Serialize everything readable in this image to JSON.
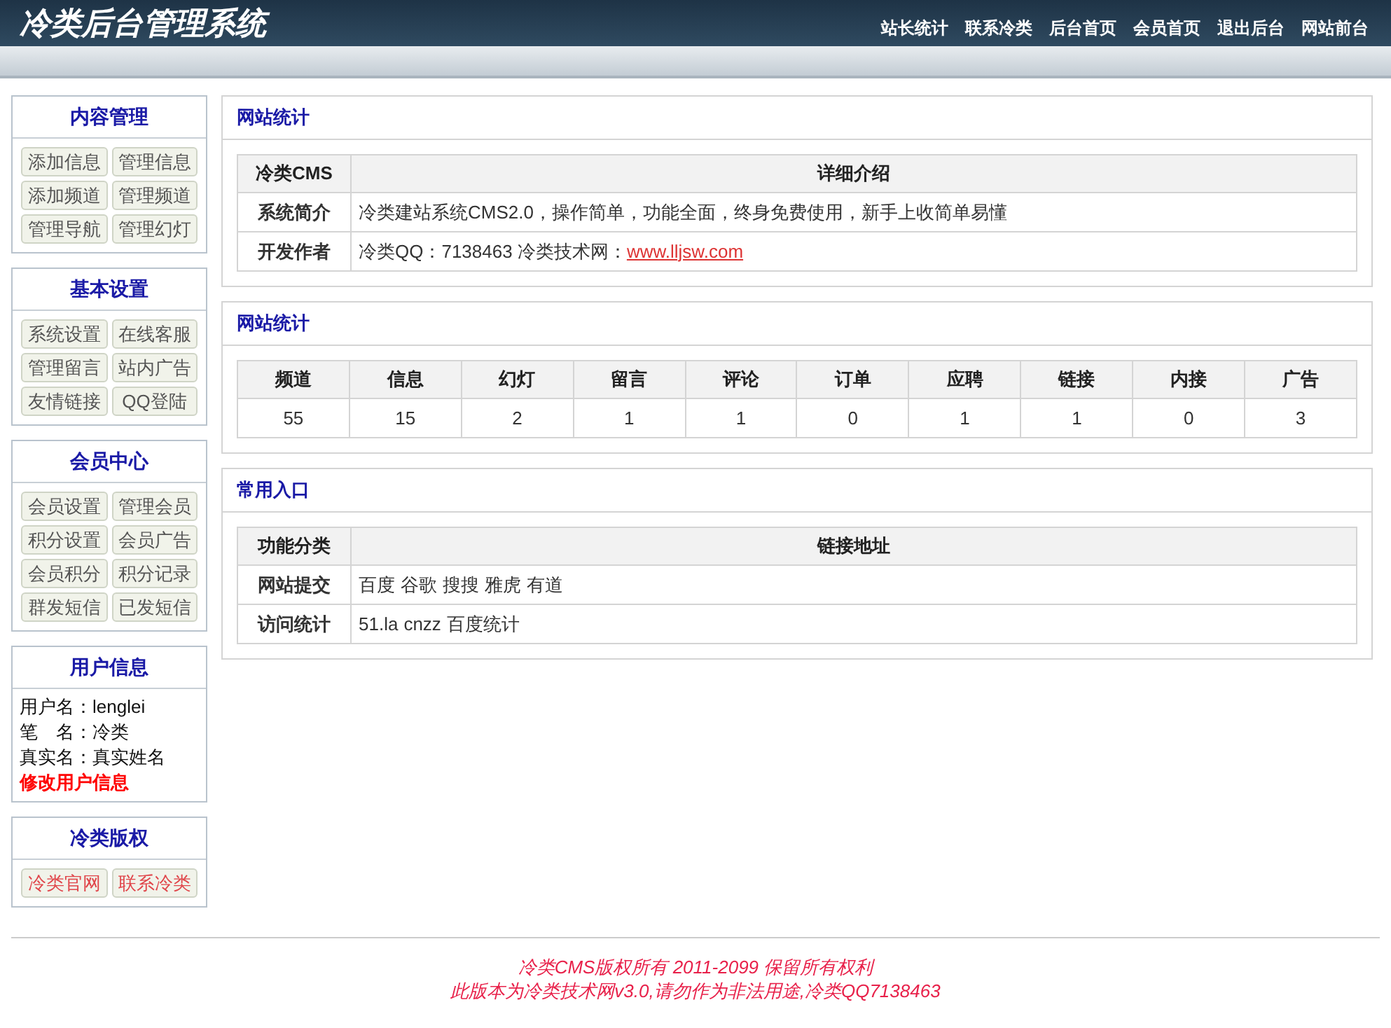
{
  "header": {
    "title": "冷类后台管理系统",
    "nav": [
      "站长统计",
      "联系冷类",
      "后台首页",
      "会员首页",
      "退出后台",
      "网站前台"
    ]
  },
  "sidebar": [
    {
      "kind": "buttons",
      "title": "内容管理",
      "buttons": [
        {
          "label": "添加信息",
          "kind": "plain"
        },
        {
          "label": "管理信息",
          "kind": "plain"
        },
        {
          "label": "添加频道",
          "kind": "plain"
        },
        {
          "label": "管理频道",
          "kind": "plain"
        },
        {
          "label": "管理导航",
          "kind": "plain"
        },
        {
          "label": "管理幻灯",
          "kind": "plain"
        }
      ]
    },
    {
      "kind": "buttons",
      "title": "基本设置",
      "buttons": [
        {
          "label": "系统设置",
          "kind": "plain"
        },
        {
          "label": "在线客服",
          "kind": "plain"
        },
        {
          "label": "管理留言",
          "kind": "plain"
        },
        {
          "label": "站内广告",
          "kind": "plain"
        },
        {
          "label": "友情链接",
          "kind": "plain"
        },
        {
          "label": "QQ登陆",
          "kind": "plain"
        }
      ]
    },
    {
      "kind": "buttons",
      "title": "会员中心",
      "buttons": [
        {
          "label": "会员设置",
          "kind": "plain"
        },
        {
          "label": "管理会员",
          "kind": "plain"
        },
        {
          "label": "积分设置",
          "kind": "plain"
        },
        {
          "label": "会员广告",
          "kind": "plain"
        },
        {
          "label": "会员积分",
          "kind": "plain"
        },
        {
          "label": "积分记录",
          "kind": "plain"
        },
        {
          "label": "群发短信",
          "kind": "plain"
        },
        {
          "label": "已发短信",
          "kind": "plain"
        }
      ]
    },
    {
      "kind": "info",
      "title": "用户信息",
      "lines": [
        "用户名：lenglei",
        "笔　名：冷类",
        "真实名：真实姓名"
      ],
      "link": "修改用户信息"
    },
    {
      "kind": "buttons",
      "title": "冷类版权",
      "buttons": [
        {
          "label": "冷类官网",
          "kind": "red"
        },
        {
          "label": "联系冷类",
          "kind": "red"
        }
      ]
    }
  ],
  "intro": {
    "title": "网站统计",
    "columns": [
      "冷类CMS",
      "详细介绍"
    ],
    "rows": [
      {
        "label": "系统简介",
        "text": "冷类建站系统CMS2.0，操作简单，功能全面，终身免费使用，新手上收简单易懂"
      },
      {
        "label": "开发作者",
        "text": "冷类QQ：7138463 冷类技术网：",
        "link": "www.lljsw.com"
      }
    ]
  },
  "stats": {
    "title": "网站统计",
    "columns": [
      "频道",
      "信息",
      "幻灯",
      "留言",
      "评论",
      "订单",
      "应聘",
      "链接",
      "内接",
      "广告"
    ],
    "values": [
      "55",
      "15",
      "2",
      "1",
      "1",
      "0",
      "1",
      "1",
      "0",
      "3"
    ]
  },
  "links": {
    "title": "常用入口",
    "columns": [
      "功能分类",
      "链接地址"
    ],
    "rows": [
      {
        "label": "网站提交",
        "items": [
          "百度",
          "谷歌",
          "搜搜",
          "雅虎",
          "有道"
        ]
      },
      {
        "label": "访问统计",
        "items": [
          "51.la",
          "cnzz",
          "百度统计"
        ]
      }
    ]
  },
  "footer": [
    "冷类CMS版权所有 2011-2099 保留所有权利",
    "此版本为冷类技术网v3.0,请勿作为非法用途,冷类QQ7138463"
  ]
}
